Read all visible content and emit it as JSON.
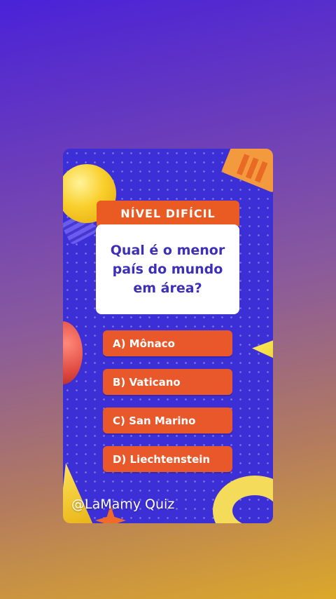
{
  "quiz": {
    "level": "NÍVEL DIFÍCIL",
    "question": "Qual é o menor país do mundo em área?",
    "answers": [
      "A) Mônaco",
      "B) Vaticano",
      "C) San Marino",
      "D) Liechtenstein"
    ]
  },
  "watermark": "@LaMamy Quiz",
  "colors": {
    "card_background": "#3d2fd6",
    "answer_background": "#e8582a",
    "question_text": "#3d2fb8"
  }
}
